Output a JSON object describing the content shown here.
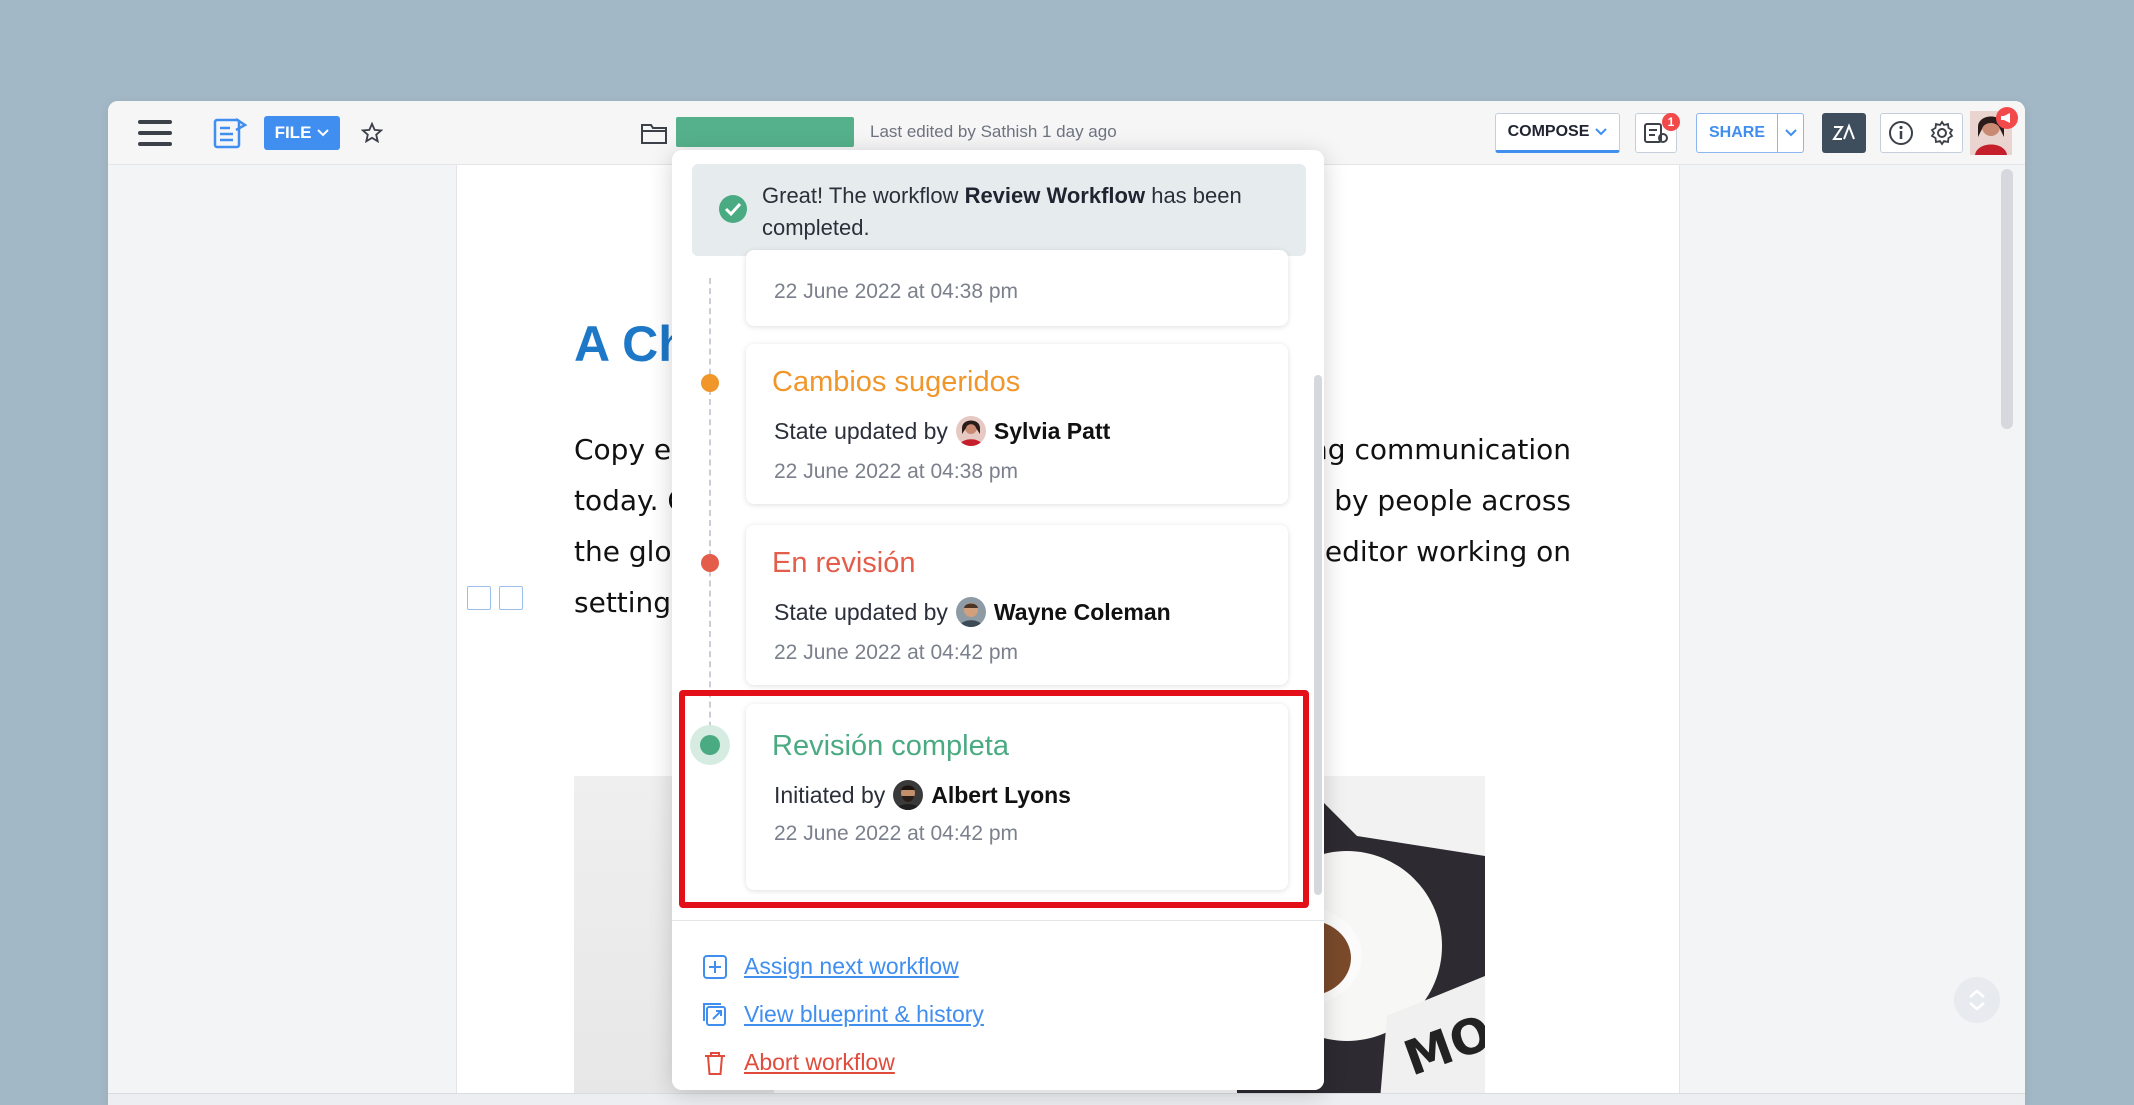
{
  "toolbar": {
    "file_label": "FILE",
    "last_edited": "Last edited by Sathish 1 day ago",
    "compose_label": "COMPOSE",
    "review_badge_count": "1",
    "share_label": "SHARE",
    "brand_colors": {
      "accent": "#3f8ef0",
      "title_bar": "#55b18c",
      "za": "#3f4e5c"
    }
  },
  "document": {
    "heading_fragment": "A Ch",
    "para_left": [
      "Copy e",
      "today. C",
      "the glo",
      "setting"
    ],
    "para_right": [
      "ng communication",
      "d by people across",
      "editor working on"
    ]
  },
  "workflow_panel": {
    "success_prefix": "Great! The workflow ",
    "success_workflow": "Review Workflow",
    "success_suffix": " has been completed.",
    "cards": [
      {
        "date": "22 June 2022 at 04:38 pm"
      },
      {
        "state": "Cambios sugeridos",
        "state_color": "#f0962a",
        "by_label": "State updated by",
        "who": "Sylvia Patt",
        "date": "22 June 2022 at 04:38 pm"
      },
      {
        "state": "En revisión",
        "state_color": "#e35d4a",
        "by_label": "State updated by",
        "who": "Wayne Coleman",
        "date": "22 June 2022 at 04:42 pm"
      },
      {
        "state": "Revisión completa",
        "state_color": "#4aaa82",
        "by_label": "Initiated by",
        "who": "Albert Lyons",
        "date": "22 June 2022 at 04:42 pm"
      }
    ],
    "footer": {
      "assign": "Assign next workflow",
      "blueprint": "View blueprint & history",
      "abort": "Abort workflow"
    }
  }
}
